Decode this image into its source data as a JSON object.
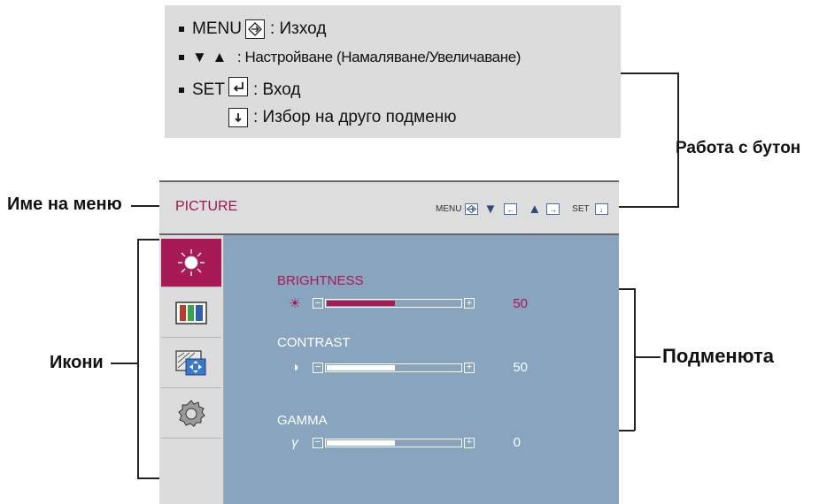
{
  "legend": {
    "rows": [
      {
        "prefix": "MENU",
        "desc": ": Изход"
      },
      {
        "desc": ": Настройване (Намаляване/Увеличаване)"
      },
      {
        "prefix": "SET",
        "desc": ": Вход"
      },
      {
        "desc": ": Избор на друго подменю"
      }
    ]
  },
  "callouts": {
    "menu_name": "Име на меню",
    "icons": "Икони",
    "button_operation": "Работа с бутон",
    "submenus": "Подменюта"
  },
  "osd": {
    "title": "PICTURE",
    "keys": {
      "menu": "MENU",
      "set": "SET"
    },
    "submenus": [
      {
        "name": "BRIGHTNESS",
        "symbol": "☀",
        "value": "50",
        "level": 0.5,
        "active": true
      },
      {
        "name": "CONTRAST",
        "symbol": "◑",
        "value": "50",
        "level": 0.5,
        "active": false
      },
      {
        "name": "GAMMA",
        "symbol": "γ",
        "value": "0",
        "level": 0.5,
        "active": false
      }
    ],
    "icons": [
      "brightness-icon",
      "color-bars-icon",
      "screen-adjust-icon",
      "gear-icon"
    ]
  },
  "colors": {
    "accent": "#a81a55",
    "osd_bg": "#88a4bf",
    "panel": "#dcdcdc"
  }
}
